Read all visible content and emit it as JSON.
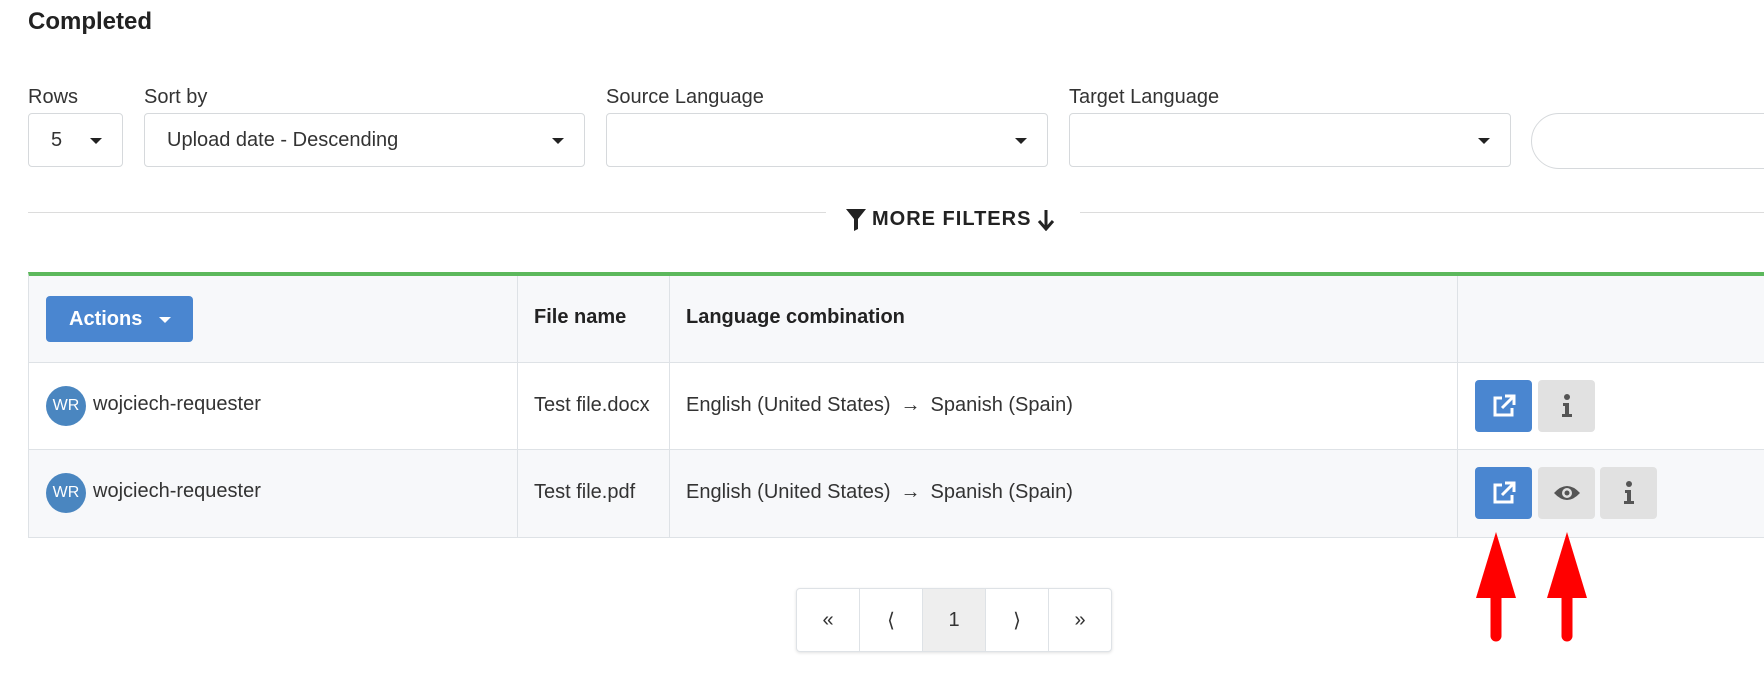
{
  "page": {
    "title": "Completed"
  },
  "filters": {
    "rows": {
      "label": "Rows",
      "value": "5"
    },
    "sort_by": {
      "label": "Sort by",
      "value": "Upload date - Descending"
    },
    "source_language": {
      "label": "Source Language",
      "value": ""
    },
    "target_language": {
      "label": "Target Language",
      "value": ""
    },
    "more_filters_label": "MORE FILTERS"
  },
  "table": {
    "actions_label": "Actions",
    "headers": {
      "file_name": "File name",
      "language_combination": "Language combination"
    },
    "rows": [
      {
        "avatar": "WR",
        "user": "wojciech-requester",
        "file_name": "Test file.docx",
        "source": "English (United States)",
        "target": "Spanish (Spain)",
        "buttons": [
          "external-link-icon",
          "info-icon"
        ]
      },
      {
        "avatar": "WR",
        "user": "wojciech-requester",
        "file_name": "Test file.pdf",
        "source": "English (United States)",
        "target": "Spanish (Spain)",
        "buttons": [
          "external-link-icon",
          "eye-icon",
          "info-icon"
        ]
      }
    ]
  },
  "pagination": {
    "first": "«",
    "prev": "⟨",
    "current": "1",
    "next": "⟩",
    "last": "»"
  },
  "colors": {
    "accent_blue": "#4a86d0",
    "table_top_border": "#5cb85c",
    "annotation_red": "#ff0000"
  }
}
